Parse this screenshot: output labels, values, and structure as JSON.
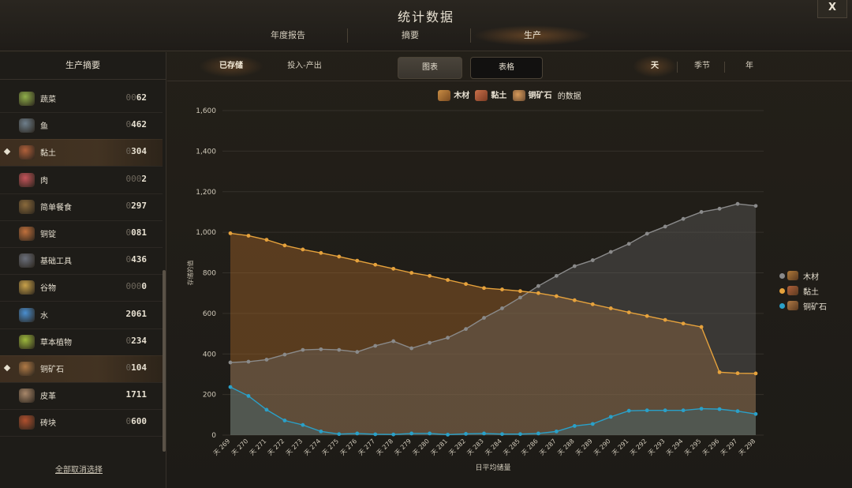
{
  "window": {
    "title": "统计数据",
    "close_label": "X"
  },
  "main_tabs": [
    {
      "label": "年度报告",
      "active": false
    },
    {
      "label": "摘要",
      "active": false
    },
    {
      "label": "生产",
      "active": true
    }
  ],
  "sidebar": {
    "title": "生产摘要",
    "items": [
      {
        "name": "蔬菜",
        "qty_dim": "00",
        "qty": "62",
        "icon": "vegetable-icon",
        "color": "#8fae4a",
        "marked": false,
        "selected": false
      },
      {
        "name": "鱼",
        "qty_dim": "0",
        "qty": "462",
        "icon": "fish-icon",
        "color": "#6e7f8c",
        "marked": false,
        "selected": false
      },
      {
        "name": "黏土",
        "qty_dim": "0",
        "qty": "304",
        "icon": "clay-icon",
        "color": "#b0603a",
        "marked": true,
        "selected": true
      },
      {
        "name": "肉",
        "qty_dim": "000",
        "qty": "2",
        "icon": "meat-icon",
        "color": "#c4545a",
        "marked": false,
        "selected": false
      },
      {
        "name": "简单餐食",
        "qty_dim": "0",
        "qty": "297",
        "icon": "meal-icon",
        "color": "#8a6a3c",
        "marked": false,
        "selected": false
      },
      {
        "name": "铜锭",
        "qty_dim": "0",
        "qty": "081",
        "icon": "copper-ingot-icon",
        "color": "#c0703c",
        "marked": false,
        "selected": false
      },
      {
        "name": "基础工具",
        "qty_dim": "0",
        "qty": "436",
        "icon": "tools-icon",
        "color": "#6a6f7a",
        "marked": false,
        "selected": false
      },
      {
        "name": "谷物",
        "qty_dim": "000",
        "qty": "0",
        "icon": "grain-icon",
        "color": "#c9a24a",
        "marked": false,
        "selected": false
      },
      {
        "name": "水",
        "qty_dim": "",
        "qty": "2061",
        "icon": "water-icon",
        "color": "#4a8fd0",
        "marked": false,
        "selected": false
      },
      {
        "name": "草本植物",
        "qty_dim": "0",
        "qty": "234",
        "icon": "herb-icon",
        "color": "#9cb83c",
        "marked": false,
        "selected": false
      },
      {
        "name": "铜矿石",
        "qty_dim": "0",
        "qty": "104",
        "icon": "copper-ore-icon",
        "color": "#b07a46",
        "marked": true,
        "selected": true
      },
      {
        "name": "皮革",
        "qty_dim": "",
        "qty": "1711",
        "icon": "leather-icon",
        "color": "#a8876a",
        "marked": false,
        "selected": false
      },
      {
        "name": "砖块",
        "qty_dim": "0",
        "qty": "600",
        "icon": "brick-icon",
        "color": "#b0502e",
        "marked": false,
        "selected": false
      }
    ],
    "deselect_all": "全部取消选择"
  },
  "subbar": {
    "mode_tabs": [
      {
        "label": "已存储",
        "active": true
      },
      {
        "label": "投入-产出",
        "active": false
      }
    ],
    "view_tabs": [
      {
        "label": "图表",
        "active": true
      },
      {
        "label": "表格",
        "active": false
      }
    ],
    "period_tabs": [
      {
        "label": "天",
        "active": true
      },
      {
        "label": "季节",
        "active": false
      },
      {
        "label": "年",
        "active": false
      }
    ]
  },
  "chart_header": {
    "items": [
      {
        "label": "木材",
        "icon": "wood-icon",
        "color": "#b07a3a"
      },
      {
        "label": "黏土",
        "icon": "clay-icon",
        "color": "#b0603a"
      },
      {
        "label": "铜矿石",
        "icon": "copper-ore-icon",
        "color": "#b07a46"
      }
    ],
    "suffix": "的数据"
  },
  "chart_data": {
    "type": "area",
    "x": [
      "天 269",
      "天 270",
      "天 271",
      "天 272",
      "天 273",
      "天 274",
      "天 275",
      "天 276",
      "天 277",
      "天 278",
      "天 279",
      "天 280",
      "天 281",
      "天 282",
      "天 283",
      "天 284",
      "天 285",
      "天 286",
      "天 287",
      "天 288",
      "天 289",
      "天 290",
      "天 291",
      "天 292",
      "天 293",
      "天 294",
      "天 295",
      "天 296",
      "天 297",
      "天 298"
    ],
    "xlabel": "日平均储量",
    "ylabel": "存储的值",
    "ylim": [
      0,
      1600
    ],
    "yticks": [
      0,
      200,
      400,
      600,
      800,
      1000,
      1200,
      1400,
      1600
    ],
    "ytick_labels": [
      "0",
      "200",
      "400",
      "600",
      "800",
      "1,000",
      "1,200",
      "1,400",
      "1,600"
    ],
    "grid": true,
    "legend_position": "right",
    "series": [
      {
        "name": "木材",
        "color": "#8a8a8a",
        "values": [
          358,
          362,
          372,
          397,
          420,
          423,
          420,
          410,
          440,
          463,
          428,
          455,
          480,
          523,
          578,
          625,
          678,
          735,
          785,
          833,
          862,
          903,
          943,
          993,
          1028,
          1066,
          1100,
          1116,
          1140,
          1130
        ]
      },
      {
        "name": "黏土",
        "color": "#e6a23c",
        "values": [
          995,
          983,
          963,
          935,
          915,
          898,
          880,
          860,
          840,
          820,
          800,
          785,
          765,
          745,
          725,
          718,
          710,
          700,
          685,
          665,
          645,
          625,
          605,
          587,
          568,
          550,
          533,
          310,
          305,
          304
        ]
      },
      {
        "name": "铜矿石",
        "color": "#2aa0c8",
        "values": [
          237,
          193,
          125,
          72,
          50,
          18,
          5,
          8,
          4,
          3,
          8,
          8,
          2,
          6,
          8,
          5,
          5,
          8,
          18,
          45,
          55,
          90,
          120,
          122,
          122,
          122,
          130,
          128,
          118,
          104
        ]
      }
    ]
  }
}
